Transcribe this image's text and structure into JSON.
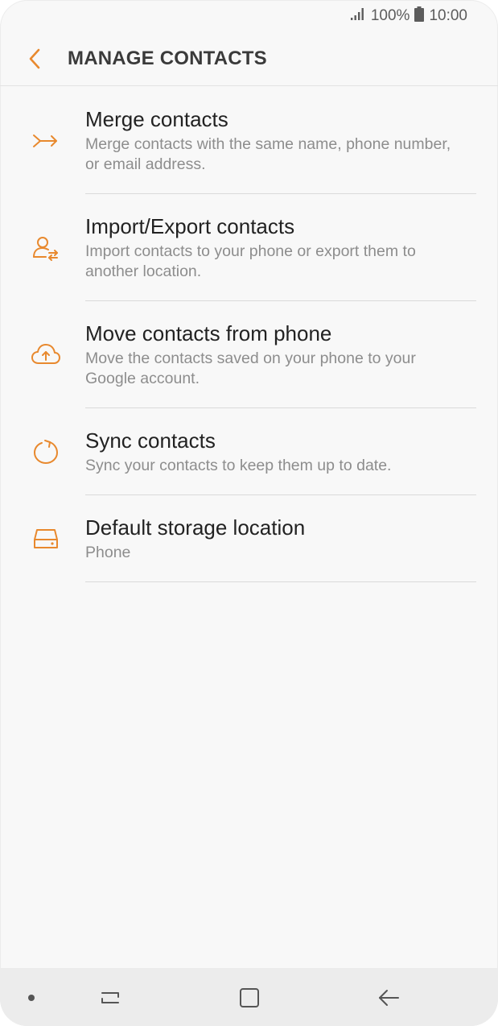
{
  "status": {
    "battery_text": "100%",
    "time": "10:00"
  },
  "appbar": {
    "title": "MANAGE CONTACTS"
  },
  "items": [
    {
      "title": "Merge contacts",
      "subtitle": "Merge contacts with the same name, phone number, or email address.",
      "icon": "merge-icon"
    },
    {
      "title": "Import/Export contacts",
      "subtitle": "Import contacts to your phone or export them to another location.",
      "icon": "import-export-icon"
    },
    {
      "title": "Move contacts from phone",
      "subtitle": "Move the contacts saved on your phone to your Google account.",
      "icon": "cloud-upload-icon"
    },
    {
      "title": "Sync contacts",
      "subtitle": "Sync your contacts to keep them up to date.",
      "icon": "sync-icon"
    },
    {
      "title": "Default storage location",
      "subtitle": "Phone",
      "icon": "storage-icon"
    }
  ],
  "colors": {
    "accent": "#e8892e",
    "background": "#f8f8f8",
    "navbar": "#ececec"
  }
}
